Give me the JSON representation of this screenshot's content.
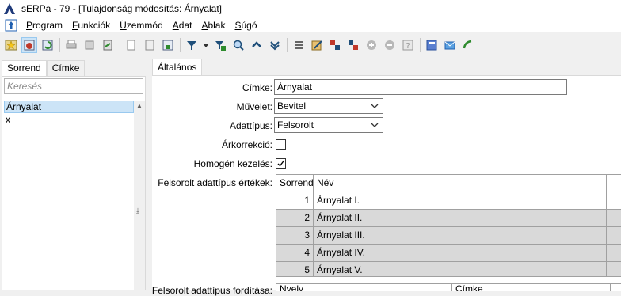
{
  "window": {
    "title": "sERPa - 79 - [Tulajdonság módosítás: Árnyalat]"
  },
  "menu": [
    {
      "label": "Program",
      "ul": "P",
      "rest": "rogram"
    },
    {
      "label": "Funkciók",
      "ul": "F",
      "rest": "unkciók"
    },
    {
      "label": "Üzemmód",
      "ul": "Ü",
      "rest": "zemmód"
    },
    {
      "label": "Adat",
      "ul": "A",
      "rest": "dat"
    },
    {
      "label": "Ablak",
      "ul": "A",
      "rest": "blak"
    },
    {
      "label": "Súgó",
      "ul": "S",
      "rest": "úgó"
    }
  ],
  "toolbar_icons": [
    "star-icon",
    "tag-icon",
    "refresh-icon",
    "print-icon",
    "print-preview-icon",
    "export-icon",
    "copy-icon",
    "copy-icon-2",
    "save-copy-icon",
    "filter-icon",
    "filter-dropdown-icon",
    "filter-clear-icon",
    "search-icon",
    "collapse-icon",
    "expand-icon",
    "list-icon",
    "edit-icon",
    "swap-icon",
    "swap-2-icon",
    "add-icon",
    "remove-icon",
    "help-icon",
    "calculator-icon",
    "mail-icon",
    "phone-icon"
  ],
  "left": {
    "tabs": [
      "Sorrend",
      "Címke"
    ],
    "active_tab": "Sorrend",
    "search_placeholder": "Keresés",
    "items": [
      "Árnyalat",
      "x"
    ],
    "selected_item": "Árnyalat"
  },
  "right": {
    "tab": "Általános",
    "fields": {
      "cimke_label": "Címke:",
      "cimke_value": "Árnyalat",
      "muvelet_label": "Művelet:",
      "muvelet_value": "Bevitel",
      "adattipus_label": "Adattípus:",
      "adattipus_value": "Felsorolt",
      "arkorrekcio_label": "Árkorrekció:",
      "arkorrekcio_checked": false,
      "homogen_label": "Homogén kezelés:",
      "homogen_checked": true,
      "felsorolt_label": "Felsorolt adattípus értékek:",
      "forditas_label": "Felsorolt adattípus fordítása:"
    },
    "grid": {
      "columns": [
        "Sorrend",
        "Név"
      ],
      "rows": [
        {
          "order": "1",
          "name": "Árnyalat I."
        },
        {
          "order": "2",
          "name": "Árnyalat II."
        },
        {
          "order": "3",
          "name": "Árnyalat III."
        },
        {
          "order": "4",
          "name": "Árnyalat IV."
        },
        {
          "order": "5",
          "name": "Árnyalat V."
        }
      ]
    },
    "grid2": {
      "columns": [
        "Nyelv",
        "Címke"
      ]
    }
  }
}
